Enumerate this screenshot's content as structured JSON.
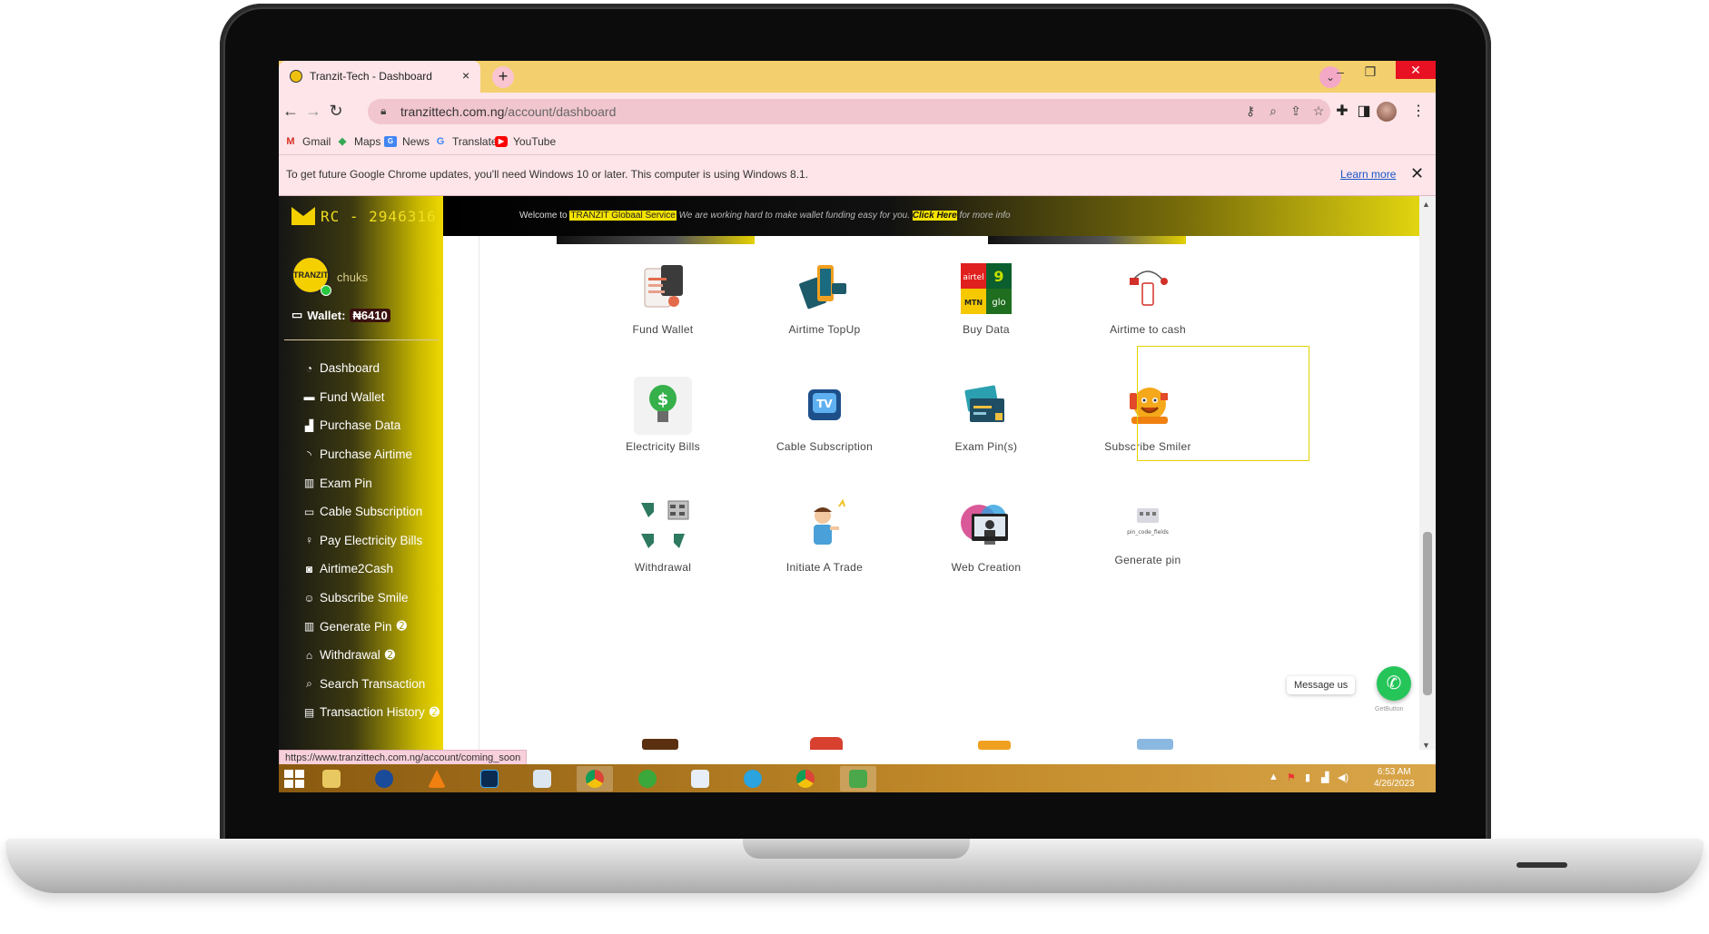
{
  "browser": {
    "tab_title": "Tranzit-Tech - Dashboard",
    "tab_close": "×",
    "new_tab": "+",
    "url_domain": "tranzittech.com.ng",
    "url_path": "/account/dashboard",
    "bookmarks": [
      "Gmail",
      "Maps",
      "News",
      "Translate",
      "YouTube"
    ],
    "info_text": "To get future Google Chrome updates, you'll need Windows 10 or later. This computer is using Windows 8.1.",
    "learn_more": "Learn more",
    "info_close": "✕"
  },
  "sidebar": {
    "rc": "RC - 2946316",
    "logo_text": "TRANZIT",
    "username": "chuks",
    "wallet_label": "Wallet:",
    "wallet_amount": "₦6410",
    "items": [
      {
        "label": "Dashboard",
        "icon": "dashboard-icon"
      },
      {
        "label": "Fund Wallet",
        "icon": "credit-card-icon"
      },
      {
        "label": "Purchase Data",
        "icon": "signal-icon"
      },
      {
        "label": "Purchase Airtime",
        "icon": "rss-icon"
      },
      {
        "label": "Exam Pin",
        "icon": "barcode-icon"
      },
      {
        "label": "Cable Subscription",
        "icon": "monitor-icon"
      },
      {
        "label": "Pay Electricity Bills",
        "icon": "lightbulb-icon"
      },
      {
        "label": "Airtime2Cash",
        "icon": "money-icon"
      },
      {
        "label": "Subscribe Smile",
        "icon": "smile-icon"
      },
      {
        "label": "Generate Pin",
        "icon": "barcode-icon"
      },
      {
        "label": "Withdrawal",
        "icon": "bank-icon"
      },
      {
        "label": "Search Transaction",
        "icon": "search-icon"
      },
      {
        "label": "Transaction History",
        "icon": "history-icon"
      }
    ]
  },
  "notice": {
    "welcome": "Welcome to",
    "brand": "TRANZIT Globaal Service",
    "message": "We are working hard to make wallet funding easy for you.",
    "click_here": "Click Here",
    "more": "for more info"
  },
  "services": [
    {
      "label": "Fund Wallet",
      "icon": "fund-wallet-icon"
    },
    {
      "label": "Airtime TopUp",
      "icon": "airtime-topup-icon"
    },
    {
      "label": "Buy Data",
      "icon": "buy-data-icon"
    },
    {
      "label": "Airtime to cash",
      "icon": "airtime-to-cash-icon"
    },
    {
      "label": "Electricity Bills",
      "icon": "electricity-icon"
    },
    {
      "label": "Cable Subscription",
      "icon": "cable-tv-icon"
    },
    {
      "label": "Exam Pin(s)",
      "icon": "exam-pin-icon"
    },
    {
      "label": "Subscribe Smiler",
      "icon": "smile-icon"
    },
    {
      "label": "Withdrawal",
      "icon": "withdrawal-icon"
    },
    {
      "label": "Initiate A Trade",
      "icon": "trade-icon"
    },
    {
      "label": "Web Creation",
      "icon": "web-creation-icon"
    },
    {
      "label": "Generate pin",
      "icon": "pin-code-icon"
    }
  ],
  "generate_pin_caption": "pin_code_fields",
  "data_logos": {
    "airtel": "airtel",
    "nine": "9",
    "mtn": "MTN",
    "glo": "glo",
    "tv": "TV"
  },
  "whatsapp": {
    "message": "Message us",
    "getbutton": "GetButton"
  },
  "status_url": "https://www.tranzittech.com.ng/account/coming_soon",
  "taskbar": {
    "time": "6:53 AM",
    "date": "4/26/2023"
  },
  "colors": {
    "accent": "#f3d000",
    "tab_bar": "#f3d06d",
    "toolbar": "#fde5e9",
    "whatsapp": "#25c559"
  }
}
